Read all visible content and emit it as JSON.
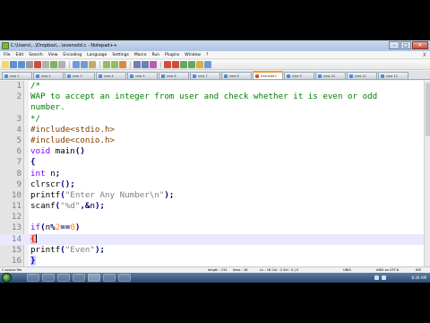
{
  "window": {
    "title": "C:\\Users\\...\\Dropbox\\...\\evenodd.c - Notepad++",
    "minimize_glyph": "–",
    "maximize_glyph": "□",
    "close_glyph": "✕"
  },
  "menu": [
    "File",
    "Edit",
    "Search",
    "View",
    "Encoding",
    "Language",
    "Settings",
    "Macro",
    "Run",
    "Plugins",
    "Window",
    "?"
  ],
  "menu_close": "X",
  "tabs": [
    {
      "label": "new 1"
    },
    {
      "label": "new 2"
    },
    {
      "label": "new 3"
    },
    {
      "label": "new 4"
    },
    {
      "label": "new 5"
    },
    {
      "label": "new 6"
    },
    {
      "label": "new 7"
    },
    {
      "label": "new 8"
    },
    {
      "label": "evenodd.c",
      "active": true
    },
    {
      "label": "new 9"
    },
    {
      "label": "new 10"
    },
    {
      "label": "new 11"
    },
    {
      "label": "new 12"
    }
  ],
  "code_lines": [
    {
      "n": "1",
      "segments": [
        {
          "t": "/*",
          "c": "c-comment"
        }
      ]
    },
    {
      "n": "2",
      "segments": [
        {
          "t": "WAP to accept an integer from user and check whether it is even or odd",
          "c": "c-comment"
        }
      ]
    },
    {
      "n": "",
      "segments": [
        {
          "t": "number.",
          "c": "c-comment"
        }
      ]
    },
    {
      "n": "3",
      "segments": [
        {
          "t": "*/",
          "c": "c-comment"
        }
      ]
    },
    {
      "n": "4",
      "segments": [
        {
          "t": "#include<stdio.h>",
          "c": "c-pre"
        }
      ]
    },
    {
      "n": "5",
      "segments": [
        {
          "t": "#include<conio.h>",
          "c": "c-pre"
        }
      ]
    },
    {
      "n": "6",
      "segments": [
        {
          "t": "void",
          "c": "c-kw"
        },
        {
          "t": " main",
          "c": ""
        },
        {
          "t": "()",
          "c": "c-op"
        }
      ]
    },
    {
      "n": "7",
      "segments": [
        {
          "t": "{",
          "c": "c-op"
        }
      ]
    },
    {
      "n": "8",
      "segments": [
        {
          "t": "int",
          "c": "c-kw"
        },
        {
          "t": " n",
          "c": ""
        },
        {
          "t": ";",
          "c": "c-op"
        }
      ]
    },
    {
      "n": "9",
      "segments": [
        {
          "t": "clrscr",
          "c": ""
        },
        {
          "t": "();",
          "c": "c-op"
        }
      ]
    },
    {
      "n": "10",
      "segments": [
        {
          "t": "printf",
          "c": ""
        },
        {
          "t": "(",
          "c": "c-op"
        },
        {
          "t": "\"Enter Any Number\\n\"",
          "c": "c-str"
        },
        {
          "t": ");",
          "c": "c-op"
        }
      ]
    },
    {
      "n": "11",
      "segments": [
        {
          "t": "scanf",
          "c": ""
        },
        {
          "t": "(",
          "c": "c-op"
        },
        {
          "t": "\"%d\"",
          "c": "c-str"
        },
        {
          "t": ",&",
          "c": "c-op"
        },
        {
          "t": "n",
          "c": ""
        },
        {
          "t": ");",
          "c": "c-op"
        }
      ]
    },
    {
      "n": "12",
      "segments": []
    },
    {
      "n": "13",
      "segments": [
        {
          "t": "if",
          "c": "c-kw"
        },
        {
          "t": "(",
          "c": "c-op"
        },
        {
          "t": "n",
          "c": ""
        },
        {
          "t": "%",
          "c": "c-op"
        },
        {
          "t": "2",
          "c": "c-num"
        },
        {
          "t": "==",
          "c": "c-op"
        },
        {
          "t": "0",
          "c": "c-num"
        },
        {
          "t": ")",
          "c": "c-op"
        }
      ]
    },
    {
      "n": "14",
      "segments": [
        {
          "t": "{",
          "c": "c-brace-hl"
        }
      ],
      "current": true,
      "caret": true
    },
    {
      "n": "15",
      "segments": [
        {
          "t": "printf",
          "c": ""
        },
        {
          "t": "(",
          "c": "c-op"
        },
        {
          "t": "\"Even\"",
          "c": "c-str"
        },
        {
          "t": ");",
          "c": "c-op"
        }
      ]
    },
    {
      "n": "16",
      "segments": [
        {
          "t": "}",
          "c": "c-brace-hl2"
        }
      ]
    },
    {
      "n": "17",
      "segments": []
    }
  ],
  "status": {
    "filetype": "C source file",
    "length": "length : 231",
    "lines": "lines : 18",
    "position": "Ln : 16    Col : 2    Sel : 0 | 0",
    "eol": "UNIX",
    "encoding": "ANSI as UTF-8",
    "mode": "INS"
  },
  "clock": "8:26 AM",
  "colors": {
    "comment": "#008000",
    "preprocessor": "#804000",
    "keyword": "#8000ff",
    "string": "#808080",
    "number": "#ff8000",
    "current_line": "#e8e8ff"
  }
}
